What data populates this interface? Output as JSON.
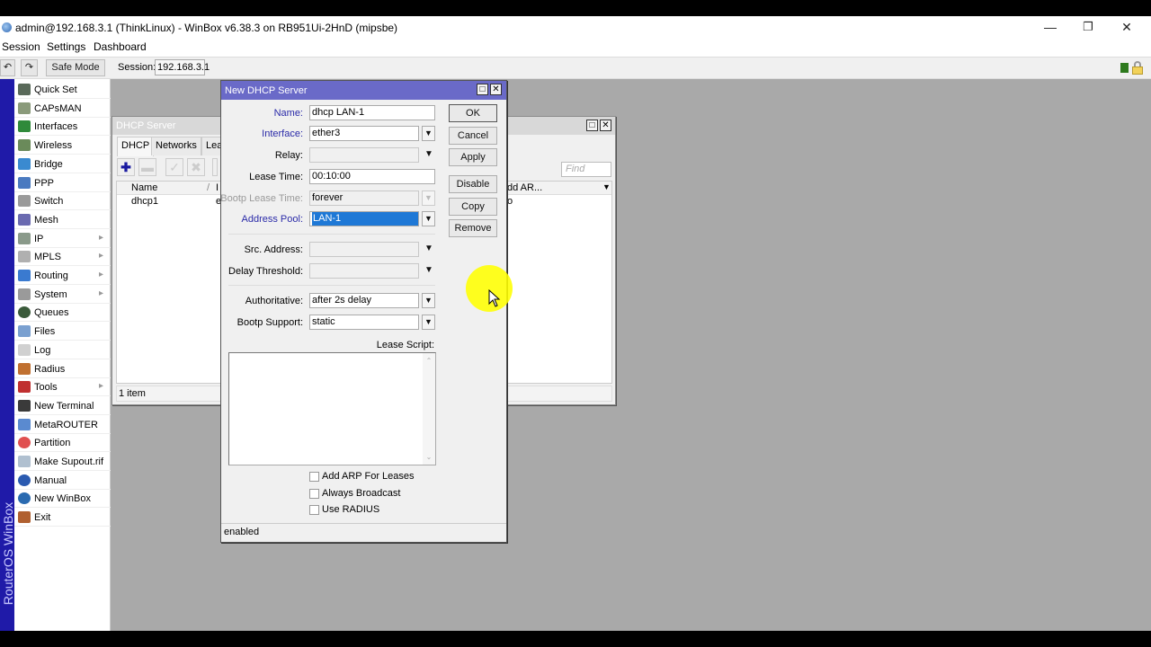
{
  "window": {
    "title": "admin@192.168.3.1 (ThinkLinux) - WinBox v6.38.3 on RB951Ui-2HnD (mipsbe)",
    "controls": [
      "minimize",
      "restore",
      "close"
    ]
  },
  "menu": {
    "items": [
      "Session",
      "Settings",
      "Dashboard"
    ]
  },
  "toolbar": {
    "undo_icon": "undo-icon",
    "redo_icon": "redo-icon",
    "safe_mode_label": "Safe Mode",
    "session_label": "Session:",
    "session_value": "192.168.3.1",
    "status_color": "#2e7a1e"
  },
  "sidebar": {
    "brand": "RouterOS WinBox",
    "items": [
      {
        "label": "Quick Set",
        "icon": "quick-set-icon",
        "submenu": false
      },
      {
        "label": "CAPsMAN",
        "icon": "capsman-icon",
        "submenu": false
      },
      {
        "label": "Interfaces",
        "icon": "interfaces-icon",
        "submenu": false
      },
      {
        "label": "Wireless",
        "icon": "wireless-icon",
        "submenu": false
      },
      {
        "label": "Bridge",
        "icon": "bridge-icon",
        "submenu": false
      },
      {
        "label": "PPP",
        "icon": "ppp-icon",
        "submenu": false
      },
      {
        "label": "Switch",
        "icon": "switch-icon",
        "submenu": false
      },
      {
        "label": "Mesh",
        "icon": "mesh-icon",
        "submenu": false
      },
      {
        "label": "IP",
        "icon": "ip-icon",
        "submenu": true
      },
      {
        "label": "MPLS",
        "icon": "mpls-icon",
        "submenu": true
      },
      {
        "label": "Routing",
        "icon": "routing-icon",
        "submenu": true
      },
      {
        "label": "System",
        "icon": "system-icon",
        "submenu": true
      },
      {
        "label": "Queues",
        "icon": "queues-icon",
        "submenu": false
      },
      {
        "label": "Files",
        "icon": "files-icon",
        "submenu": false
      },
      {
        "label": "Log",
        "icon": "log-icon",
        "submenu": false
      },
      {
        "label": "Radius",
        "icon": "radius-icon",
        "submenu": false
      },
      {
        "label": "Tools",
        "icon": "tools-icon",
        "submenu": true
      },
      {
        "label": "New Terminal",
        "icon": "terminal-icon",
        "submenu": false
      },
      {
        "label": "MetaROUTER",
        "icon": "metarouter-icon",
        "submenu": false
      },
      {
        "label": "Partition",
        "icon": "partition-icon",
        "submenu": false
      },
      {
        "label": "Make Supout.rif",
        "icon": "supout-icon",
        "submenu": false
      },
      {
        "label": "Manual",
        "icon": "manual-icon",
        "submenu": false
      },
      {
        "label": "New WinBox",
        "icon": "new-winbox-icon",
        "submenu": false
      },
      {
        "label": "Exit",
        "icon": "exit-icon",
        "submenu": false
      }
    ]
  },
  "dhcp_list": {
    "title": "DHCP Server",
    "tabs": [
      "DHCP",
      "Networks",
      "Leas"
    ],
    "active_tab": "DHCP",
    "find_placeholder": "Find",
    "columns": [
      "Name",
      "/",
      "I",
      "dd AR..."
    ],
    "rows": [
      {
        "name": "dhcp1",
        "interface": "e",
        "add_arp": "o"
      }
    ],
    "status": "1 item"
  },
  "dialog": {
    "title": "New DHCP Server",
    "fields": {
      "name": {
        "label": "Name:",
        "value": "dhcp LAN-1"
      },
      "interface": {
        "label": "Interface:",
        "value": "ether3"
      },
      "relay": {
        "label": "Relay:",
        "value": ""
      },
      "lease_time": {
        "label": "Lease Time:",
        "value": "00:10:00"
      },
      "bootp_lease_time": {
        "label": "Bootp Lease Time:",
        "value": "forever"
      },
      "address_pool": {
        "label": "Address Pool:",
        "value": "LAN-1"
      },
      "src_address": {
        "label": "Src. Address:",
        "value": ""
      },
      "delay_threshold": {
        "label": "Delay Threshold:",
        "value": ""
      },
      "authoritative": {
        "label": "Authoritative:",
        "value": "after 2s delay"
      },
      "bootp_support": {
        "label": "Bootp Support:",
        "value": "static"
      },
      "lease_script": {
        "label": "Lease Script:",
        "value": ""
      }
    },
    "checkboxes": [
      {
        "label": "Add ARP For Leases",
        "checked": false
      },
      {
        "label": "Always Broadcast",
        "checked": false
      },
      {
        "label": "Use RADIUS",
        "checked": false
      }
    ],
    "buttons": [
      "OK",
      "Cancel",
      "Apply",
      "Disable",
      "Copy",
      "Remove"
    ],
    "status": "enabled"
  }
}
